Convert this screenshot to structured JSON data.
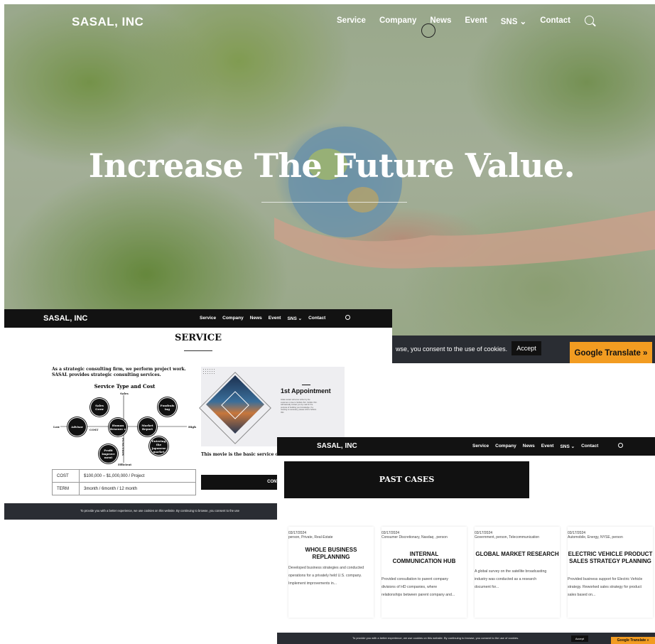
{
  "hero": {
    "logo": "SASAL, INC",
    "nav": [
      "Service",
      "Company",
      "News",
      "Event",
      "SNS ⌄",
      "Contact"
    ],
    "title": "Increase The Future Value.",
    "cookie_text": "wse, you consent to the use of cookies.",
    "accept_label": "Accept",
    "google_translate": "Google Translate »"
  },
  "service_window": {
    "logo": "SASAL, INC",
    "nav": [
      "Service",
      "Company",
      "News",
      "Event",
      "SNS ⌄",
      "Contact"
    ],
    "title": "SERVICE",
    "intro": "As a strategic consulting firm, we perform project work. SASAL provides strategic consulting services.",
    "diagram": {
      "title": "Service Type and Cost",
      "axis_top": "Sales",
      "axis_bottom": "Efficient",
      "axis_left": "Low",
      "axis_right": "High",
      "axis_cost": "COST",
      "axis_function": "FUNCTION",
      "bubbles": [
        "Sales Grow",
        "Fundrais ing",
        "Advisor",
        "Human Resourc e",
        "Market Report",
        "Entering the Japanese market",
        "Profit Improve ment"
      ]
    },
    "table": [
      {
        "label": "COST",
        "value": "$100,000 – $1,000,000 / Project"
      },
      {
        "label": "TERM",
        "value": "3month / 6month / 12 month"
      }
    ],
    "media_title": "1st Appointment",
    "media_text": "Initial contact will occur either by the customer or due to SASAL INC. SASAL INC. will basically contact you by mail for the purpose of building your knowledge. If a meeting is necessary, please inform SASAL INC.",
    "movie_text": "This movie is the basic service con When you would like to contact th the contact page.",
    "contact_label": "CONTA",
    "cookie_text": "To provide you with a better experience, we use cookies on this website. By continuing to browse, you consent to the use"
  },
  "past_cases_window": {
    "logo": "SASAL, INC",
    "nav": [
      "Service",
      "Company",
      "News",
      "Event",
      "SNS ⌄",
      "Contact"
    ],
    "banner": "PAST CASES",
    "cards": [
      {
        "date": "03/17/2024",
        "tags": "person, Private, Real-Estate",
        "title": "WHOLE BUSINESS REPLANNING",
        "text": "Developed business strategies and conducted operations for a privately held U.S. company. Implement improvements in..."
      },
      {
        "date": "03/17/2024",
        "tags": "Consumer Discretionary, Nasdaq , person",
        "title": "INTERNAL COMMUNICATION HUB",
        "text": "Provided consultation to parent company divisions of HD companies, where relationships between parent company and..."
      },
      {
        "date": "03/17/2024",
        "tags": "Government, person, Telecommunication",
        "title": "GLOBAL MARKET RESEARCH",
        "text": "A global survey on the satellite broadcasting industry was conducted as a research document for..."
      },
      {
        "date": "03/17/2024",
        "tags": "Automobile, Energy, NYSE, person",
        "title": "ELECTRIC VEHICLE PRODUCT SALES STRATEGY PLANNING",
        "text": "Provided business support for Electric Vehicle strategy. Reworked sales strategy for product sales based on..."
      }
    ],
    "cookie_text": "To provide you with a better experience, we use cookies on this website. By continuing to browse, you consent to the use of cookies.",
    "accept_label": "Accept",
    "google_translate": "Google Translate »"
  }
}
